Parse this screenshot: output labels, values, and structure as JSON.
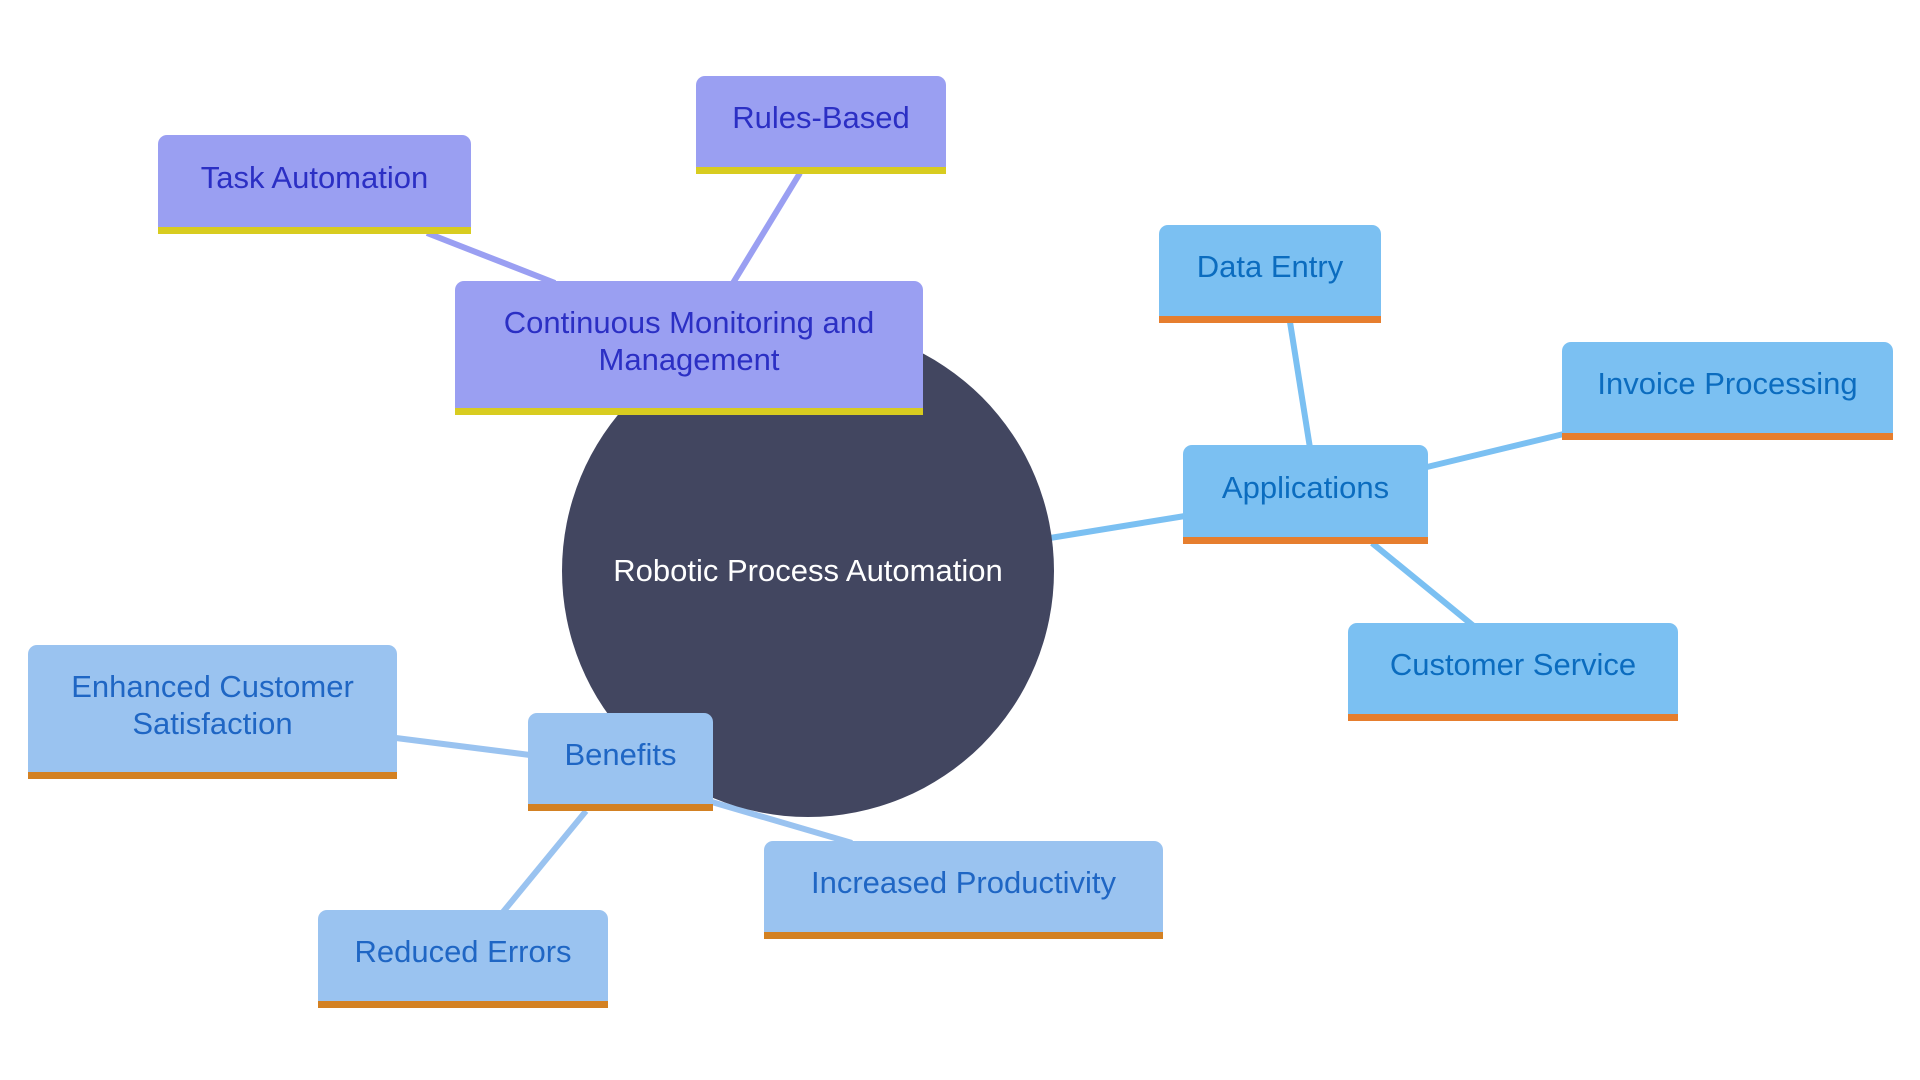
{
  "diagram": {
    "type": "mindmap",
    "root": {
      "label": "Robotic Process Automation",
      "fill": "#424660",
      "text_color": "#ffffff"
    },
    "branches": [
      {
        "id": "monitoring",
        "label": "Continuous Monitoring and Management",
        "style": {
          "fill": "#9a9ff2",
          "border": "#d8cc20",
          "text": "#2b2fc4",
          "link": "#9a9ff2"
        },
        "children": [
          {
            "id": "task-automation",
            "label": "Task Automation"
          },
          {
            "id": "rules-based",
            "label": "Rules-Based"
          }
        ]
      },
      {
        "id": "applications",
        "label": "Applications",
        "style": {
          "fill": "#7bc0f2",
          "border": "#e67e2e",
          "text": "#0b6cbf",
          "link": "#7bc0f2"
        },
        "children": [
          {
            "id": "data-entry",
            "label": "Data Entry"
          },
          {
            "id": "invoice-processing",
            "label": "Invoice Processing"
          },
          {
            "id": "customer-service",
            "label": "Customer Service"
          }
        ]
      },
      {
        "id": "benefits",
        "label": "Benefits",
        "style": {
          "fill": "#9ac3f0",
          "border": "#d38123",
          "text": "#1f66c4",
          "link": "#9ac3f0"
        },
        "children": [
          {
            "id": "enhanced-customer-satisfaction",
            "label": "Enhanced Customer Satisfaction"
          },
          {
            "id": "reduced-errors",
            "label": "Reduced Errors"
          },
          {
            "id": "increased-productivity",
            "label": "Increased Productivity"
          }
        ]
      }
    ]
  }
}
